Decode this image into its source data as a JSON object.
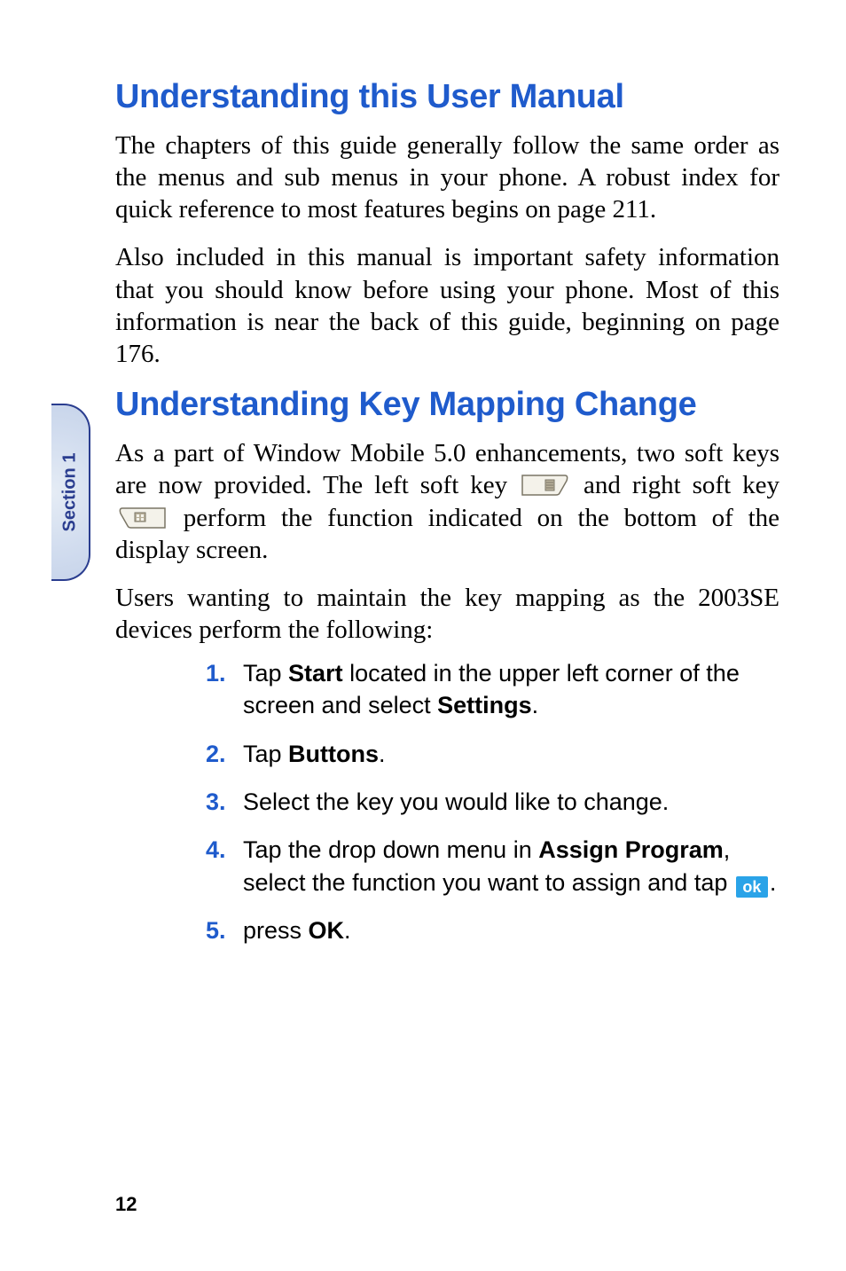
{
  "side_tab": {
    "label": "Section 1"
  },
  "heading1": "Understanding this User Manual",
  "para1": "The chapters of this guide generally follow the same order as the menus and sub menus in your phone. A robust index for quick reference to most features begins on page 211.",
  "para2": "Also included in this manual is important safety information that you should know before using your phone. Most of this information is near the back of this guide, beginning on page 176.",
  "heading2": "Understanding Key Mapping Change",
  "para3_pre": "As a part of Window Mobile  5.0 enhancements, two soft keys are  now provided. The left soft key ",
  "para3_mid": " and right soft key ",
  "para3_post": " perform the function indicated on the bottom of the display screen.",
  "para4": "Users wanting to maintain the  key mapping as the 2003SE devices perform the following:",
  "steps": {
    "s1_a": "Tap ",
    "s1_b": "Start",
    "s1_c": " located in the upper left corner of the screen and select ",
    "s1_d": "Settings",
    "s1_e": ".",
    "s2_a": "Tap ",
    "s2_b": "Buttons",
    "s2_c": ".",
    "s3": "Select the key you would like to change.",
    "s4_a": "Tap the drop down menu in ",
    "s4_b": "Assign Program",
    "s4_c": ", select the function you want to assign and tap ",
    "s4_d": ".",
    "s5_a": "press ",
    "s5_b": "OK",
    "s5_c": "."
  },
  "ok_label": "ok",
  "icons": {
    "left_soft_key": "left-softkey-icon",
    "right_soft_key": "right-softkey-icon",
    "ok_button": "ok-icon"
  },
  "page_number": "12"
}
